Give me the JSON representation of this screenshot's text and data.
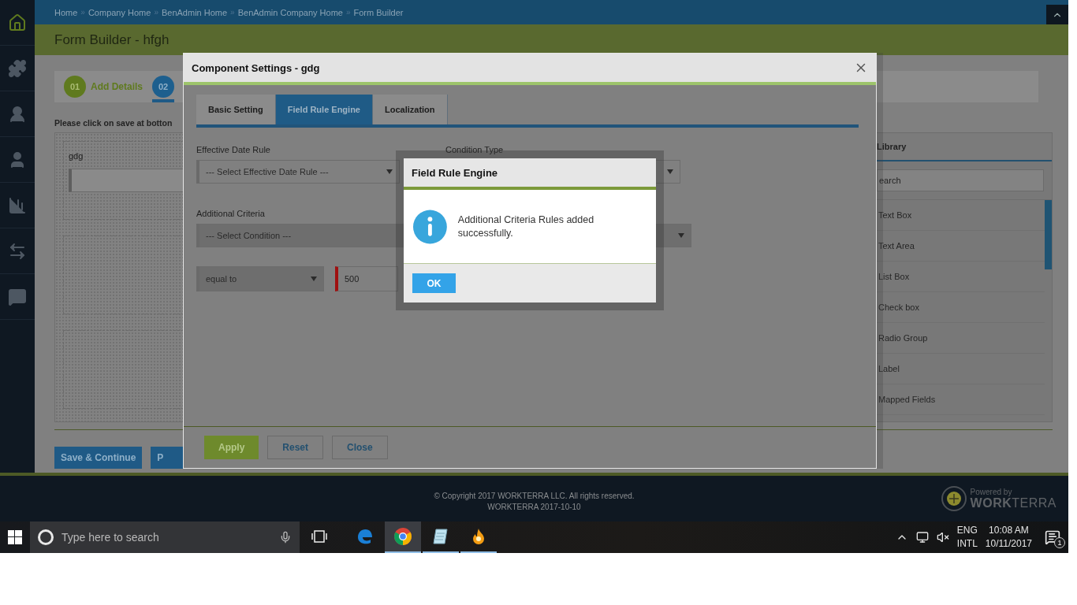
{
  "breadcrumb": {
    "separator": "»",
    "items": [
      "Home",
      "Company Home",
      "BenAdmin Home",
      "BenAdmin Company Home",
      "Form Builder"
    ]
  },
  "page_title": "Form Builder - hfgh",
  "steps": [
    {
      "number": "01",
      "label": "Add Details",
      "selected": false
    },
    {
      "number": "02",
      "selected": true
    }
  ],
  "instruction": "Please click on save at botton",
  "canvas": {
    "field_label": "gdg"
  },
  "library": {
    "title": "Library",
    "search_placeholder": "earch",
    "items": [
      "Text Box",
      "Text Area",
      "List Box",
      "Check box",
      "Radio Group",
      "Label",
      "Mapped Fields"
    ]
  },
  "page_buttons": [
    "Save & Continue",
    "P"
  ],
  "modal": {
    "title": "Component Settings - gdg",
    "tabs": [
      {
        "label": "Basic Setting",
        "selected": false
      },
      {
        "label": "Field Rule Engine",
        "selected": true
      },
      {
        "label": "Localization",
        "selected": false
      }
    ],
    "effective_date_rule": {
      "label": "Effective Date Rule",
      "value": "--- Select Effective Date Rule ---"
    },
    "condition_type": {
      "label": "Condition Type"
    },
    "additional_criteria": {
      "label": "Additional Criteria",
      "value": "--- Select Condition ---"
    },
    "operator": {
      "value": "equal to"
    },
    "amount": {
      "value": "500",
      "invalid": true
    },
    "buttons": [
      {
        "label": "Apply",
        "kind": "primary"
      },
      {
        "label": "Reset",
        "kind": "secondary"
      },
      {
        "label": "Close",
        "kind": "secondary"
      }
    ]
  },
  "alert": {
    "title": "Field Rule Engine",
    "message": "Additional Criteria Rules added successfully.",
    "button": "OK"
  },
  "footer": {
    "copyright": "© Copyright 2017 WORKTERRA LLC. All rights reserved.",
    "version": "WORKTERRA 2017-10-10",
    "powered_by": "Powered by",
    "brand": "**WORK**TERRA"
  },
  "taskbar": {
    "search_placeholder": "Type here to search",
    "apps": [
      {
        "kind": "edge",
        "running": false,
        "selected": false
      },
      {
        "kind": "chrome",
        "running": true,
        "selected": true
      },
      {
        "kind": "notes",
        "running": true,
        "selected": false
      },
      {
        "kind": "flame",
        "running": true,
        "selected": false
      }
    ],
    "language": "ENG",
    "layout": "INTL",
    "time": "10:08 AM",
    "date": "10/11/2017",
    "notifications": "1"
  }
}
